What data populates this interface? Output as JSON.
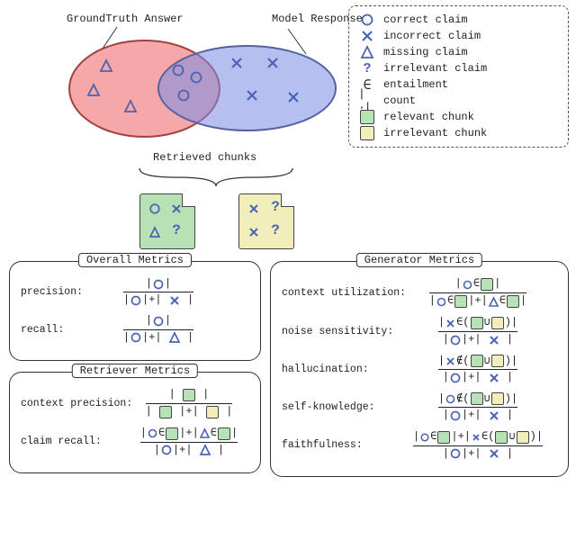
{
  "labels": {
    "gt_answer": "GroundTruth Answer",
    "model_response": "Model Response",
    "retrieved_chunks": "Retrieved chunks"
  },
  "legend": {
    "correct_claim": "correct claim",
    "incorrect_claim": "incorrect claim",
    "missing_claim": "missing claim",
    "irrelevant_claim": "irrelevant claim",
    "entailment": "entailment",
    "count": "count",
    "relevant_chunk": "relevant chunk",
    "irrelevant_chunk": "irrelevant chunk"
  },
  "panels": {
    "overall": {
      "title": "Overall Metrics",
      "precision_label": "precision:",
      "recall_label": "recall:"
    },
    "retriever": {
      "title": "Retriever Metrics",
      "context_precision_label": "context precision:",
      "claim_recall_label": "claim recall:"
    },
    "generator": {
      "title": "Generator Metrics",
      "context_utilization_label": "context utilization:",
      "noise_sensitivity_label": "noise sensitivity:",
      "hallucination_label": "hallucination:",
      "self_knowledge_label": "self-knowledge:",
      "faithfulness_label": "faithfulness:"
    }
  },
  "chart_data": {
    "type": "diagram",
    "venn": {
      "ground_truth_only": [
        "missing",
        "missing",
        "missing"
      ],
      "intersection": [
        "correct",
        "correct",
        "correct"
      ],
      "model_only": [
        "incorrect",
        "incorrect",
        "incorrect",
        "incorrect"
      ]
    },
    "retrieved_chunks": [
      {
        "type": "relevant",
        "contents": [
          "correct",
          "incorrect",
          "missing",
          "irrelevant"
        ]
      },
      {
        "type": "irrelevant",
        "contents": [
          "incorrect",
          "irrelevant",
          "incorrect",
          "irrelevant"
        ]
      }
    ],
    "symbols": {
      "correct": {
        "icon": "circle-icon",
        "meaning": "correct claim"
      },
      "incorrect": {
        "icon": "cross-icon",
        "meaning": "incorrect claim"
      },
      "missing": {
        "icon": "triangle-icon",
        "meaning": "missing claim"
      },
      "irrelevant": {
        "icon": "question-icon",
        "meaning": "irrelevant claim"
      },
      "entailment": {
        "icon": "element-of-icon",
        "meaning": "entailment"
      },
      "count": {
        "icon": "count-icon",
        "meaning": "count"
      },
      "relevant_chunk": {
        "icon": "green-chip",
        "meaning": "relevant chunk"
      },
      "irrelevant_chunk": {
        "icon": "yellow-chip",
        "meaning": "irrelevant chunk"
      }
    },
    "metrics": {
      "overall": {
        "precision": {
          "numerator": [
            "|circle|"
          ],
          "denominator": [
            "|circle|",
            "+",
            "|cross|"
          ]
        },
        "recall": {
          "numerator": [
            "|circle|"
          ],
          "denominator": [
            "|circle|",
            "+",
            "|triangle|"
          ]
        }
      },
      "retriever": {
        "context_precision": {
          "numerator": [
            "|green|"
          ],
          "denominator": [
            "|green|",
            "+",
            "|yellow|"
          ]
        },
        "claim_recall": {
          "numerator": [
            "|circle ∈ green|",
            "+",
            "|triangle ∈ green|"
          ],
          "denominator": [
            "|circle|",
            "+",
            "|triangle|"
          ]
        }
      },
      "generator": {
        "context_utilization": {
          "numerator": [
            "|circle ∈ green|"
          ],
          "denominator": [
            "|circle ∈ green|",
            "+",
            "|triangle ∈ green|"
          ]
        },
        "noise_sensitivity": {
          "numerator": [
            "|cross ∈ (green ∪ yellow)|"
          ],
          "denominator": [
            "|circle|",
            "+",
            "|cross|"
          ]
        },
        "hallucination": {
          "numerator": [
            "|cross ∉ (green ∪ yellow)|"
          ],
          "denominator": [
            "|circle|",
            "+",
            "|cross|"
          ]
        },
        "self_knowledge": {
          "numerator": [
            "|circle ∉ (green ∪ yellow)|"
          ],
          "denominator": [
            "|circle|",
            "+",
            "|cross|"
          ]
        },
        "faithfulness": {
          "numerator": [
            "|circle ∈ green|",
            "+",
            "|cross ∈ (green ∪ yellow)|"
          ],
          "denominator": [
            "|circle|",
            "+",
            "|cross|"
          ]
        }
      }
    },
    "colors": {
      "ground_truth": "#e98a8a",
      "model_response": "#9aa9e6",
      "relevant_chunk": "#b7e2b5",
      "irrelevant_chunk": "#f2eebb",
      "stroke": "#4b63b5"
    }
  }
}
